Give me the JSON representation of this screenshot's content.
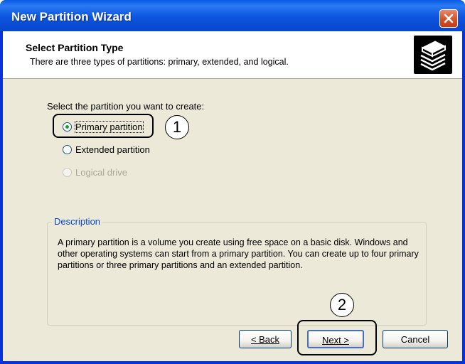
{
  "window": {
    "title": "New Partition Wizard"
  },
  "header": {
    "title": "Select Partition Type",
    "subtitle": "There are three types of partitions: primary, extended, and logical."
  },
  "content": {
    "prompt": "Select the partition you want to create:",
    "options": [
      {
        "label": "Primary partition",
        "selected": true,
        "enabled": true
      },
      {
        "label": "Extended partition",
        "selected": false,
        "enabled": true
      },
      {
        "label": "Logical drive",
        "selected": false,
        "enabled": false
      }
    ],
    "description": {
      "caption": "Description",
      "text": "A primary partition is a volume you create using free space on a basic disk. Windows and other operating systems can start from a primary partition. You can create up to four primary partitions or three primary partitions and an extended partition."
    }
  },
  "buttons": {
    "back": "< Back",
    "next": "Next >",
    "cancel": "Cancel"
  },
  "annotations": {
    "step1": "1",
    "step2": "2"
  },
  "icons": {
    "close": "close-icon",
    "wizard": "disk-partition-icon"
  },
  "colors": {
    "titlebar": "#0a5ae6",
    "client": "#ece9d8",
    "group_caption": "#0046d5",
    "radio_dot": "#21a121"
  }
}
